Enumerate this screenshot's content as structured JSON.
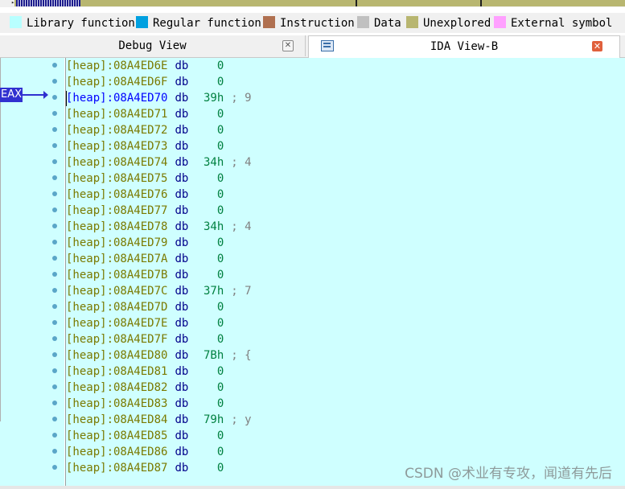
{
  "legend": [
    {
      "label": "Library function",
      "color": "#b8ffff",
      "icon": "library-function-swatch"
    },
    {
      "label": "Regular function",
      "color": "#00a0e0",
      "icon": "regular-function-swatch"
    },
    {
      "label": "Instruction",
      "color": "#b07050",
      "icon": "instruction-swatch"
    },
    {
      "label": "Data",
      "color": "#c0c0c0",
      "icon": "data-swatch"
    },
    {
      "label": "Unexplored",
      "color": "#b8b670",
      "icon": "unexplored-swatch"
    },
    {
      "label": "External symbol",
      "color": "#ffa0ff",
      "icon": "external-symbol-swatch"
    }
  ],
  "tabs": {
    "debug": {
      "label": "Debug View"
    },
    "ida": {
      "label": "IDA View-B"
    }
  },
  "register_label": "EAX",
  "colors": {
    "background": "#cfffff",
    "address": "#7a7a00",
    "keyword": "#00008b",
    "value": "#008040",
    "comment": "#808080",
    "eax": "#3030d0"
  },
  "lines": [
    {
      "addr": "[heap]:08A4ED6E",
      "op": "db",
      "val": "0",
      "cmt": ""
    },
    {
      "addr": "[heap]:08A4ED6F",
      "op": "db",
      "val": "0",
      "cmt": ""
    },
    {
      "addr": "[heap]:08A4ED70",
      "op": "db",
      "val": "39h",
      "cmt": "; 9",
      "current": true
    },
    {
      "addr": "[heap]:08A4ED71",
      "op": "db",
      "val": "0",
      "cmt": ""
    },
    {
      "addr": "[heap]:08A4ED72",
      "op": "db",
      "val": "0",
      "cmt": ""
    },
    {
      "addr": "[heap]:08A4ED73",
      "op": "db",
      "val": "0",
      "cmt": ""
    },
    {
      "addr": "[heap]:08A4ED74",
      "op": "db",
      "val": "34h",
      "cmt": "; 4"
    },
    {
      "addr": "[heap]:08A4ED75",
      "op": "db",
      "val": "0",
      "cmt": ""
    },
    {
      "addr": "[heap]:08A4ED76",
      "op": "db",
      "val": "0",
      "cmt": ""
    },
    {
      "addr": "[heap]:08A4ED77",
      "op": "db",
      "val": "0",
      "cmt": ""
    },
    {
      "addr": "[heap]:08A4ED78",
      "op": "db",
      "val": "34h",
      "cmt": "; 4"
    },
    {
      "addr": "[heap]:08A4ED79",
      "op": "db",
      "val": "0",
      "cmt": ""
    },
    {
      "addr": "[heap]:08A4ED7A",
      "op": "db",
      "val": "0",
      "cmt": ""
    },
    {
      "addr": "[heap]:08A4ED7B",
      "op": "db",
      "val": "0",
      "cmt": ""
    },
    {
      "addr": "[heap]:08A4ED7C",
      "op": "db",
      "val": "37h",
      "cmt": "; 7"
    },
    {
      "addr": "[heap]:08A4ED7D",
      "op": "db",
      "val": "0",
      "cmt": ""
    },
    {
      "addr": "[heap]:08A4ED7E",
      "op": "db",
      "val": "0",
      "cmt": ""
    },
    {
      "addr": "[heap]:08A4ED7F",
      "op": "db",
      "val": "0",
      "cmt": ""
    },
    {
      "addr": "[heap]:08A4ED80",
      "op": "db",
      "val": "7Bh",
      "cmt": "; {"
    },
    {
      "addr": "[heap]:08A4ED81",
      "op": "db",
      "val": "0",
      "cmt": ""
    },
    {
      "addr": "[heap]:08A4ED82",
      "op": "db",
      "val": "0",
      "cmt": ""
    },
    {
      "addr": "[heap]:08A4ED83",
      "op": "db",
      "val": "0",
      "cmt": ""
    },
    {
      "addr": "[heap]:08A4ED84",
      "op": "db",
      "val": "79h",
      "cmt": "; y"
    },
    {
      "addr": "[heap]:08A4ED85",
      "op": "db",
      "val": "0",
      "cmt": ""
    },
    {
      "addr": "[heap]:08A4ED86",
      "op": "db",
      "val": "0",
      "cmt": ""
    },
    {
      "addr": "[heap]:08A4ED87",
      "op": "db",
      "val": "0",
      "cmt": ""
    }
  ],
  "watermark": "CSDN @术业有专攻，闻道有先后"
}
